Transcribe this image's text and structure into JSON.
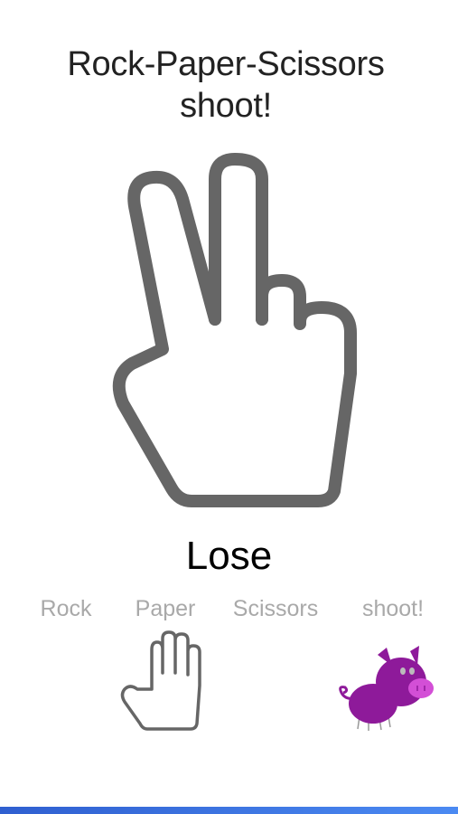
{
  "title": {
    "line1": "Rock-Paper-Scissors",
    "line2": "shoot!"
  },
  "opponent_choice": {
    "icon": "scissors-hand-icon",
    "stroke_color": "#666666"
  },
  "result": {
    "text": "Lose"
  },
  "choices": [
    {
      "label": "Rock"
    },
    {
      "label": "Paper"
    },
    {
      "label": "Scissors"
    },
    {
      "label": "shoot!"
    }
  ],
  "player_choice": {
    "icon": "paper-hand-icon"
  },
  "mascot": {
    "icon": "pig-icon",
    "color": "#8e1a9a"
  },
  "colors": {
    "choice_text": "#a9a9a9",
    "bottom_bar": "#3b72e0"
  }
}
